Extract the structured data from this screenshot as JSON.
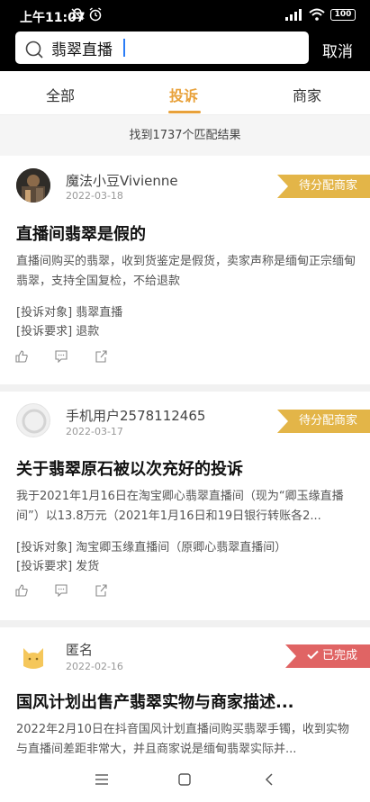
{
  "status": {
    "time": "上午11:07",
    "battery": "100"
  },
  "search": {
    "value": "翡翠直播",
    "cancel": "取消"
  },
  "tabs": [
    "全部",
    "投诉",
    "商家"
  ],
  "result_text": "找到1737个匹配结果",
  "cards": [
    {
      "user": "魔法小豆Vivienne",
      "date": "2022-03-18",
      "badge": "待分配商家",
      "title": "直播间翡翠是假的",
      "desc": "直播间购买的翡翠，收到货鉴定是假货，卖家声称是缅甸正宗缅甸翡翠，支持全国复检，不给退款",
      "target_label": "[投诉对象]",
      "target": "翡翠直播",
      "req_label": "[投诉要求]",
      "req": "退款"
    },
    {
      "user": "手机用户2578112465",
      "date": "2022-03-17",
      "badge": "待分配商家",
      "title": "关于翡翠原石被以次充好的投诉",
      "desc": "我于2021年1月16日在淘宝卿心翡翠直播间（现为“卿玉缘直播间”）以13.8万元（2021年1月16日和19日银行转账各2...",
      "target_label": "[投诉对象]",
      "target": "淘宝卿玉缘直播间（原卿心翡翠直播间）",
      "req_label": "[投诉要求]",
      "req": "发货"
    },
    {
      "user": "匿名",
      "date": "2022-02-16",
      "badge": "已完成",
      "title": "国风计划出售产翡翠实物与商家描述...",
      "desc": "2022年2月10日在抖音国风计划直播间购买翡翠手镯，收到实物与直播间差距非常大，并且商家说是缅甸翡翠实际并..."
    }
  ]
}
